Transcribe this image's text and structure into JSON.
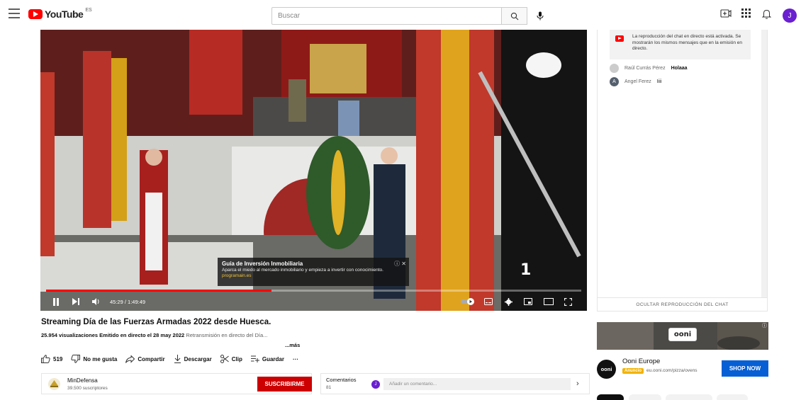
{
  "topbar": {
    "logo_text": "YouTube",
    "logo_country": "ES",
    "search_placeholder": "Buscar",
    "avatar_initial": "J"
  },
  "video": {
    "progress": 0.421,
    "time": "45:29 / 1:49:49",
    "channel_bug": "1",
    "ad_overlay": {
      "title": "Guía de Inversión Inmobiliaria",
      "description": "Aparca el miedo al mercado inmobiliario y empieza a invertir con conocimiento.",
      "url": "programain.es"
    }
  },
  "info": {
    "title": "Streaming Día de las Fuerzas Armadas 2022 desde Huesca.",
    "views": "25.954 visualizaciones",
    "date": "Emitido en directo el 28 may 2022",
    "description": "Retransmisión en directo del Día...",
    "more": "...más",
    "actions": {
      "likes": "519",
      "dislike": "No me gusta",
      "share": "Compartir",
      "download": "Descargar",
      "clip": "Clip",
      "save": "Guardar",
      "more": "···"
    }
  },
  "channel": {
    "name": "MinDefensa",
    "subscribers": "39.500 suscriptores",
    "subscribe": "SUSCRIBIRME"
  },
  "comments": {
    "label": "Comentarios",
    "count": "81",
    "avatar_initial": "J",
    "placeholder": "Añadir un comentario..."
  },
  "chat": {
    "notice": "La reproducción del chat en directo está activada. Se mostrarán los mismos mensajes que en la emisión en directo.",
    "messages": [
      {
        "author": "Raúl Currás Pérez",
        "text": "Holaaa",
        "avatar": ""
      },
      {
        "author": "Angel Ferez",
        "text": "Iiii",
        "avatar": "A"
      }
    ],
    "hide_label": "OCULTAR REPRODUCCIÓN DEL CHAT"
  },
  "ad": {
    "logo": "ooni",
    "advertiser": "Ooni Europe",
    "badge": "Anuncio",
    "domain": "eu.ooni.com/pizza/ovens",
    "cta": "SHOP NOW",
    "avatar_text": "ooni"
  },
  "colors": {
    "youtube_red": "#ff0000",
    "subscribe_red": "#cc0000",
    "cta_blue": "#065fd4",
    "avatar_purple": "#6a1fd0"
  }
}
